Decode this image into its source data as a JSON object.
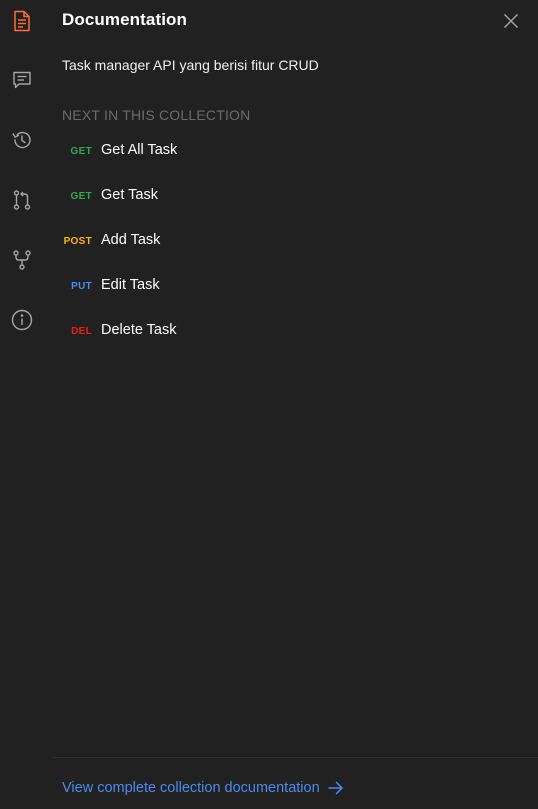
{
  "colors": {
    "background": "#212121",
    "accent_orange": "#ff6c37",
    "icon_gray": "#a6a6a6",
    "heading_gray": "#6b6b6b",
    "get_green": "#2fa84f",
    "post_orange": "#ffb400",
    "put_blue": "#4a8bef",
    "del_red": "#eb2013",
    "link_blue": "#4a8bef"
  },
  "rail": {
    "items": [
      {
        "icon": "documentation-icon",
        "active": true
      },
      {
        "icon": "comments-icon",
        "active": false
      },
      {
        "icon": "history-icon",
        "active": false
      },
      {
        "icon": "pull-request-icon",
        "active": false
      },
      {
        "icon": "fork-icon",
        "active": false
      },
      {
        "icon": "info-icon",
        "active": false
      }
    ]
  },
  "panel": {
    "title": "Documentation",
    "description": "Task manager API yang berisi fitur CRUD",
    "section_heading": "NEXT IN THIS COLLECTION",
    "requests": [
      {
        "method": "GET",
        "name": "Get All Task",
        "color": "#2fa84f"
      },
      {
        "method": "GET",
        "name": "Get Task",
        "color": "#2fa84f"
      },
      {
        "method": "POST",
        "name": "Add Task",
        "color": "#ffb400"
      },
      {
        "method": "PUT",
        "name": "Edit Task",
        "color": "#4a8bef"
      },
      {
        "method": "DEL",
        "name": "Delete Task",
        "color": "#eb2013"
      }
    ],
    "footer_link": "View complete collection documentation"
  }
}
